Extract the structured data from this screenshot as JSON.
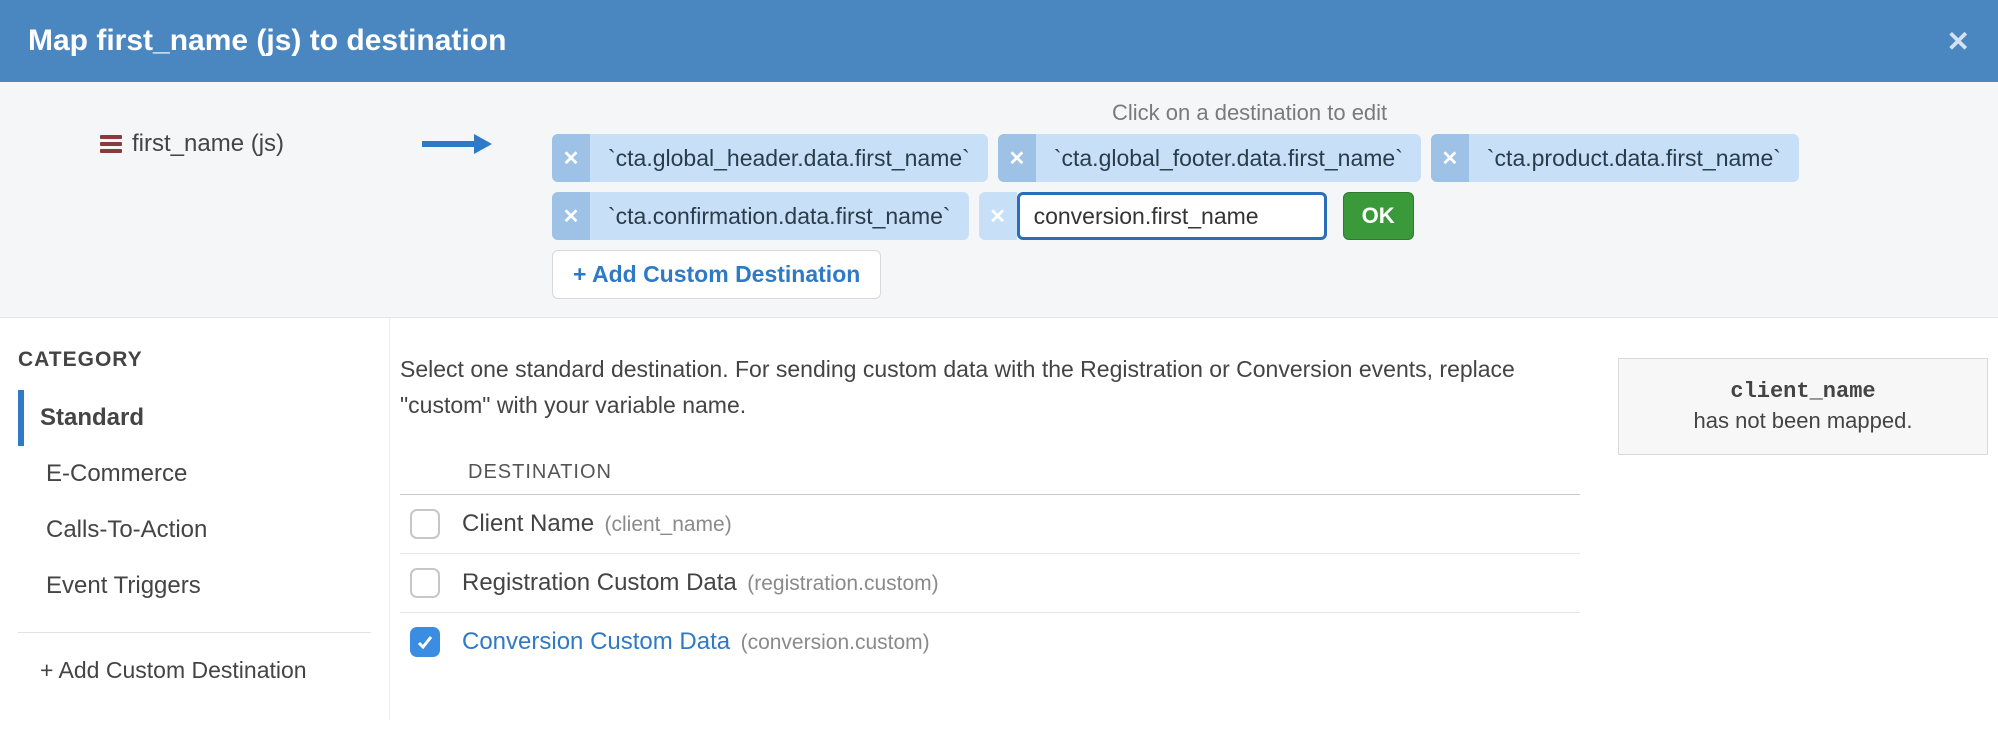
{
  "header": {
    "title": "Map first_name (js) to destination"
  },
  "mapper": {
    "source_label": "first_name (js)",
    "hint": "Click on a destination to edit",
    "destinations": [
      "`cta.global_header.data.first_name`",
      "`cta.global_footer.data.first_name`",
      "`cta.product.data.first_name`",
      "`cta.confirmation.data.first_name`"
    ],
    "input_value": "conversion.first_name",
    "ok_label": "OK",
    "add_custom_label": "+ Add Custom Destination"
  },
  "sidebar": {
    "title": "CATEGORY",
    "items": [
      {
        "label": "Standard",
        "active": true
      },
      {
        "label": "E-Commerce",
        "active": false
      },
      {
        "label": "Calls-To-Action",
        "active": false
      },
      {
        "label": "Event Triggers",
        "active": false
      }
    ],
    "add_custom_label": "+ Add Custom Destination"
  },
  "main": {
    "instruction": "Select one standard destination. For sending custom data with the Registration or Conversion events, replace \"custom\" with your variable name.",
    "dest_header": "DESTINATION",
    "rows": [
      {
        "label": "Client Name",
        "code": "(client_name)",
        "checked": false
      },
      {
        "label": "Registration Custom Data",
        "code": "(registration.custom)",
        "checked": false
      },
      {
        "label": "Conversion Custom Data",
        "code": "(conversion.custom)",
        "checked": true
      }
    ]
  },
  "tooltip": {
    "code": "client_name",
    "text": "has not been mapped."
  }
}
